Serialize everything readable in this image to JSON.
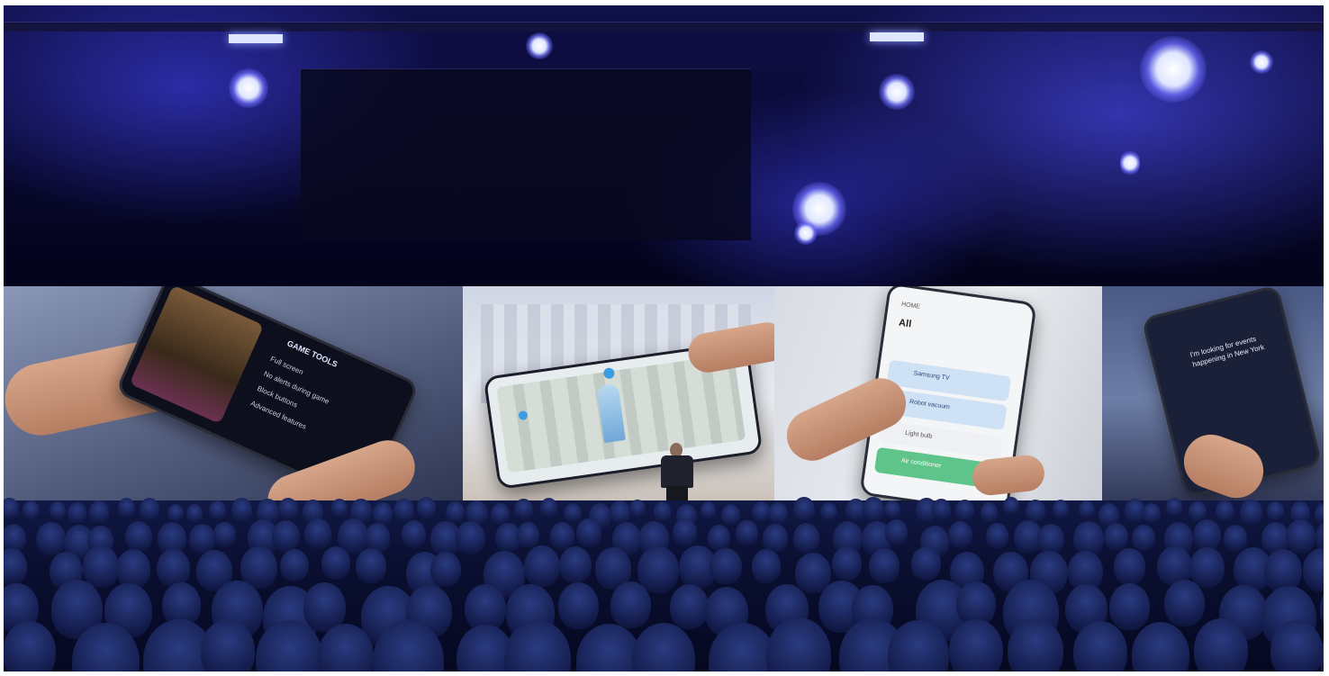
{
  "scene": {
    "description_kind": "photo",
    "colors": {
      "stage_light": "#4b4bff",
      "screen_highlight": "#e8ebf1",
      "audience": "#121a48"
    }
  },
  "screens": {
    "panel1": {
      "title": "GAME TOOLS",
      "items": [
        "Full screen",
        "No alerts during game",
        "Block buttons",
        "Advanced features"
      ]
    },
    "panel3": {
      "header": "HOME",
      "room": "All",
      "cards": [
        "Samsung TV",
        "Robot vacuum",
        "Light bulb",
        "Air conditioner"
      ]
    },
    "panel4": {
      "assistant_text": "I'm looking for events happening in New York"
    }
  }
}
